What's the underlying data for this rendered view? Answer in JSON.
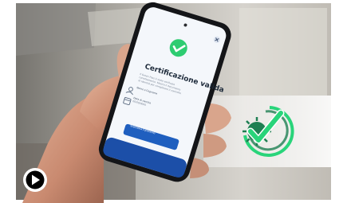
{
  "phone_screen": {
    "title": "Certificazione valida",
    "description_lines": [
      "Il Green Pass è stato verificato",
      "correttamente. Mostra il documento",
      "di identità per completare il controllo."
    ],
    "person_label": "Nome e Cognome",
    "birth_label": "Data di nascita",
    "birth_value": "00/00/0000",
    "scan_button_label": "Scansiona il prossimo"
  },
  "icons": {
    "check": "check-circle-icon",
    "close": "close-icon",
    "person": "person-icon",
    "calendar": "calendar-icon",
    "virus_check": "virus-check-logo",
    "play": "play-icon"
  },
  "colors": {
    "check_green": "#2ecc71",
    "button_blue": "#1f5fbf",
    "logo_green": "#29d47a",
    "logo_dark_green": "#1e7f52"
  }
}
